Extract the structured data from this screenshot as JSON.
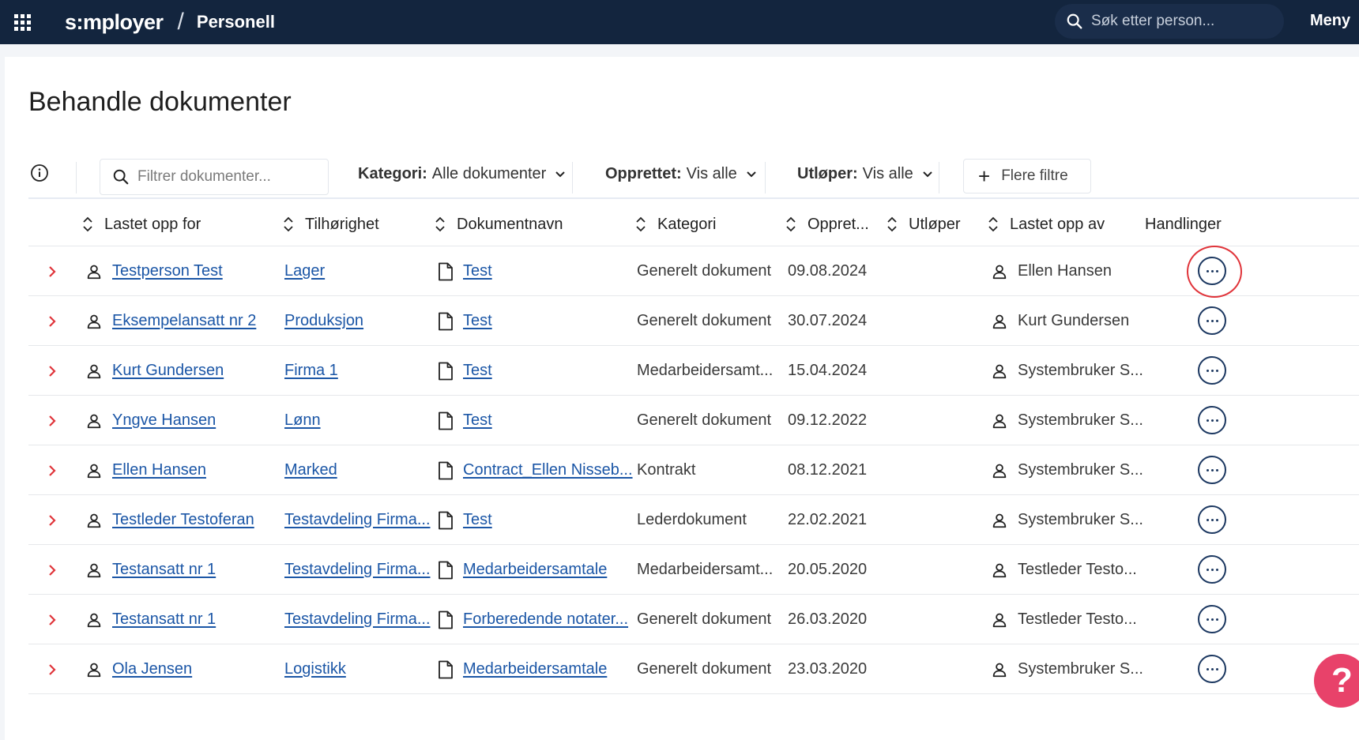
{
  "topbar": {
    "brand": "s:mployer",
    "module": "Personell",
    "search_placeholder": "Søk etter person...",
    "menu_label": "Meny",
    "menu_more": "⋮"
  },
  "page": {
    "title": "Behandle dokumenter"
  },
  "filters": {
    "search_placeholder": "Filtrer dokumenter...",
    "kategori": {
      "label": "Kategori:",
      "value": "Alle dokumenter"
    },
    "opprettet": {
      "label": "Opprettet:",
      "value": "Vis alle"
    },
    "utloper": {
      "label": "Utløper:",
      "value": "Vis alle"
    },
    "more_filters": "Flere filtre"
  },
  "columns": {
    "lastet_opp_for": "Lastet opp for",
    "tilhorighet": "Tilhørighet",
    "dokumentnavn": "Dokumentnavn",
    "kategori": "Kategori",
    "opprettet": "Oppret...",
    "utloper": "Utløper",
    "lastet_opp_av": "Lastet opp av",
    "handlinger": "Handlinger"
  },
  "rows": [
    {
      "person": "Testperson Test",
      "unit": "Lager",
      "doc": "Test",
      "category": "Generelt dokument",
      "created": "09.08.2024",
      "expires": "",
      "uploader": "Ellen Hansen"
    },
    {
      "person": "Eksempelansatt nr 2",
      "unit": "Produksjon",
      "doc": "Test",
      "category": "Generelt dokument",
      "created": "30.07.2024",
      "expires": "",
      "uploader": "Kurt Gundersen"
    },
    {
      "person": "Kurt Gundersen",
      "unit": "Firma 1",
      "doc": "Test",
      "category": "Medarbeidersamt...",
      "created": "15.04.2024",
      "expires": "",
      "uploader": "Systembruker S..."
    },
    {
      "person": "Yngve Hansen",
      "unit": "Lønn",
      "doc": "Test",
      "category": "Generelt dokument",
      "created": "09.12.2022",
      "expires": "",
      "uploader": "Systembruker S..."
    },
    {
      "person": "Ellen Hansen",
      "unit": "Marked",
      "doc": "Contract_Ellen Nisseb...",
      "category": "Kontrakt",
      "created": "08.12.2021",
      "expires": "",
      "uploader": "Systembruker S..."
    },
    {
      "person": "Testleder Testoferan",
      "unit": "Testavdeling Firma...",
      "doc": "Test",
      "category": "Lederdokument",
      "created": "22.02.2021",
      "expires": "",
      "uploader": "Systembruker S..."
    },
    {
      "person": "Testansatt nr 1",
      "unit": "Testavdeling Firma...",
      "doc": "Medarbeidersamtale",
      "category": "Medarbeidersamt...",
      "created": "20.05.2020",
      "expires": "",
      "uploader": "Testleder Testo..."
    },
    {
      "person": "Testansatt nr 1",
      "unit": "Testavdeling Firma...",
      "doc": "Forberedende notater...",
      "category": "Generelt dokument",
      "created": "26.03.2020",
      "expires": "",
      "uploader": "Testleder Testo..."
    },
    {
      "person": "Ola Jensen",
      "unit": "Logistikk",
      "doc": "Medarbeidersamtale",
      "category": "Generelt dokument",
      "created": "23.03.2020",
      "expires": "",
      "uploader": "Systembruker S..."
    }
  ],
  "help": {
    "label": "?"
  },
  "colors": {
    "topbar": "#13253e",
    "link": "#1b56a6",
    "expander": "#e0343a",
    "highlight": "#e0343a",
    "help": "#e8426a"
  }
}
